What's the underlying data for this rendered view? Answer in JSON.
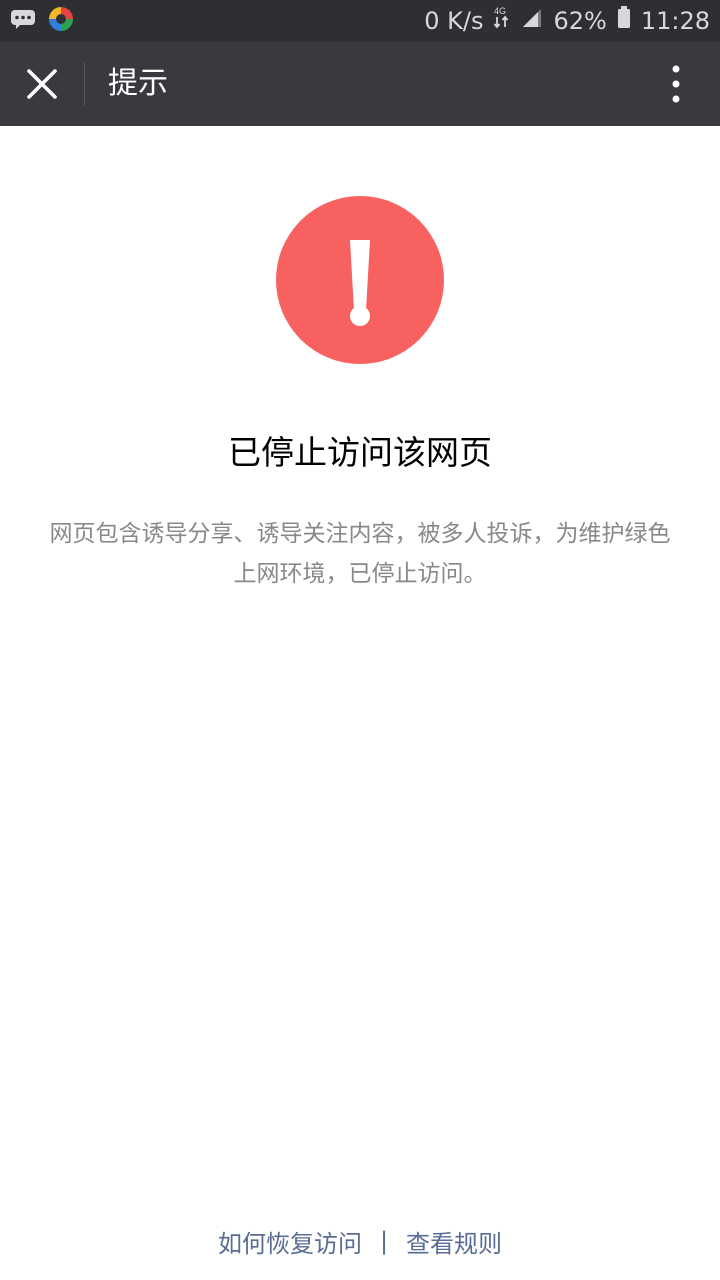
{
  "status_bar": {
    "network_speed": "0 K/s",
    "network_type": "4G",
    "battery": "62%",
    "time": "11:28",
    "icons": [
      "chat-bubble-icon",
      "app-logo-icon",
      "data-arrows-icon",
      "signal-icon",
      "battery-icon"
    ]
  },
  "nav": {
    "title": "提示",
    "close_icon": "close-icon",
    "more_icon": "more-vertical-icon"
  },
  "content": {
    "alert_icon": "warning-exclamation-icon",
    "alert_color": "#f76260",
    "heading": "已停止访问该网页",
    "description": "网页包含诱导分享、诱导关注内容，被多人投诉，为维护绿色上网环境，已停止访问。"
  },
  "footer": {
    "restore_link": "如何恢复访问",
    "separator": "|",
    "rules_link": "查看规则",
    "link_color": "#586c94"
  }
}
